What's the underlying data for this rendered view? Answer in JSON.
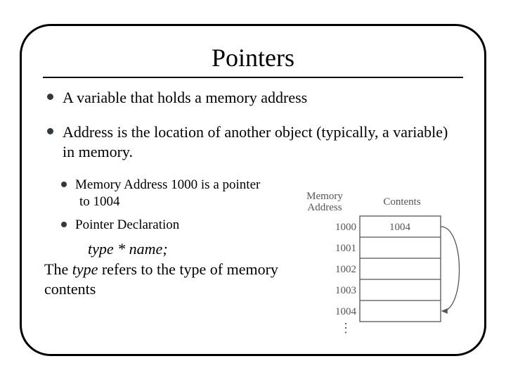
{
  "title": "Pointers",
  "bullets": {
    "b1": "A variable that holds a memory address",
    "b2": "Address is the location of another object (typically, a variable) in memory.",
    "s1_line1": "Memory Address 1000 is a pointer",
    "s1_line2": "to 1004",
    "s2": "Pointer Declaration"
  },
  "syntax": {
    "type": "type",
    "star": "*",
    "name": "name",
    "semi": ";"
  },
  "explain": {
    "prefix": "The ",
    "em": "type",
    "rest": " refers to the type of memory contents"
  },
  "diagram": {
    "header_left": "Memory",
    "header_left2": "Address",
    "header_right": "Contents",
    "rows": [
      "1000",
      "1001",
      "1002",
      "1003",
      "1004"
    ],
    "cell_value": "1004",
    "dots": "⋮"
  }
}
